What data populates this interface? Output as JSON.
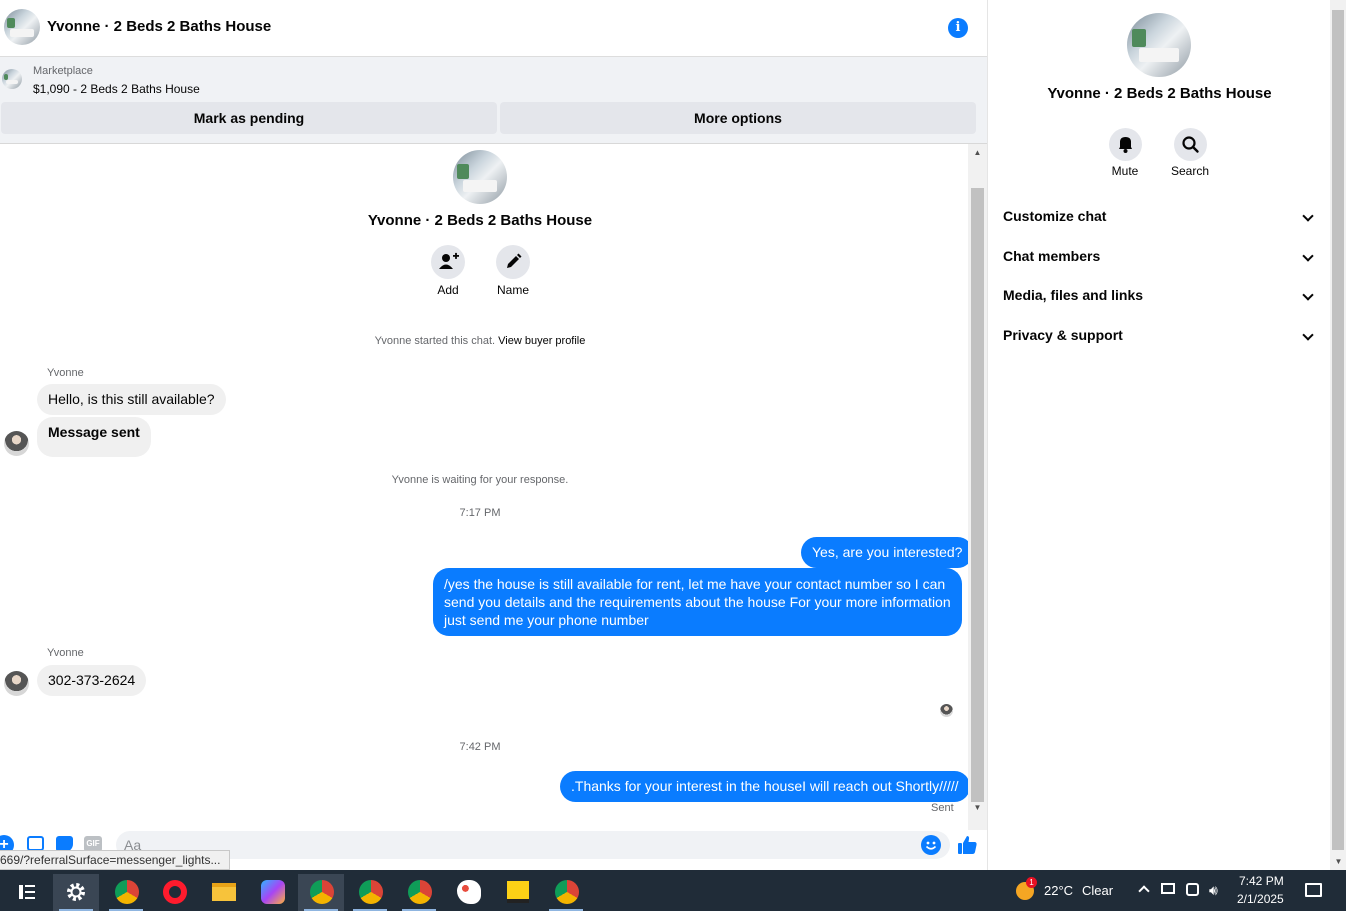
{
  "header": {
    "title": "Yvonne · 2 Beds 2 Baths House"
  },
  "marketplace": {
    "label": "Marketplace",
    "listing": "$1,090 - 2 Beds 2 Baths House",
    "mark_pending_label": "Mark as pending",
    "more_options_label": "More options"
  },
  "conversation": {
    "title": "Yvonne · 2 Beds 2 Baths House",
    "add_label": "Add",
    "name_label": "Name",
    "started_text": "Yvonne started this chat.",
    "view_profile_link": "View buyer profile",
    "sender_name": "Yvonne",
    "msg_1": "Hello, is this still available?",
    "msg_2": "Message sent",
    "waiting_text": "Yvonne is waiting for your response.",
    "time_1": "7:17 PM",
    "msg_3": "Yes, are you interested?",
    "msg_4_line_1": "/yes the house is still available for rent, let me have your contact number so I can",
    "msg_4_line_2": "send you details and the requirements about the house For  your  more  information",
    "msg_4_line_3": "just  send  me   your  phone  number",
    "sender_name_2": "Yvonne",
    "msg_5": "302-373-2624",
    "time_2": "7:42 PM",
    "msg_6": ".Thanks for your interest in the houseI will reach out Shortly/////",
    "sent_status": "Sent"
  },
  "composer": {
    "placeholder": "Aa"
  },
  "status_bar": {
    "url": "669/?referralSurface=messenger_lights..."
  },
  "right_panel": {
    "title": "Yvonne · 2 Beds 2 Baths House",
    "mute_label": "Mute",
    "search_label": "Search",
    "rows": [
      "Customize chat",
      "Chat members",
      "Media, files and links",
      "Privacy & support"
    ]
  },
  "taskbar": {
    "weather_temp": "22°C",
    "weather_desc": "Clear",
    "weather_badge": "1",
    "time": "7:42 PM",
    "date": "2/1/2025"
  },
  "colors": {
    "accent": "#0a7cff",
    "bubble_in": "#f0f0f0",
    "taskbar": "#202c38"
  }
}
